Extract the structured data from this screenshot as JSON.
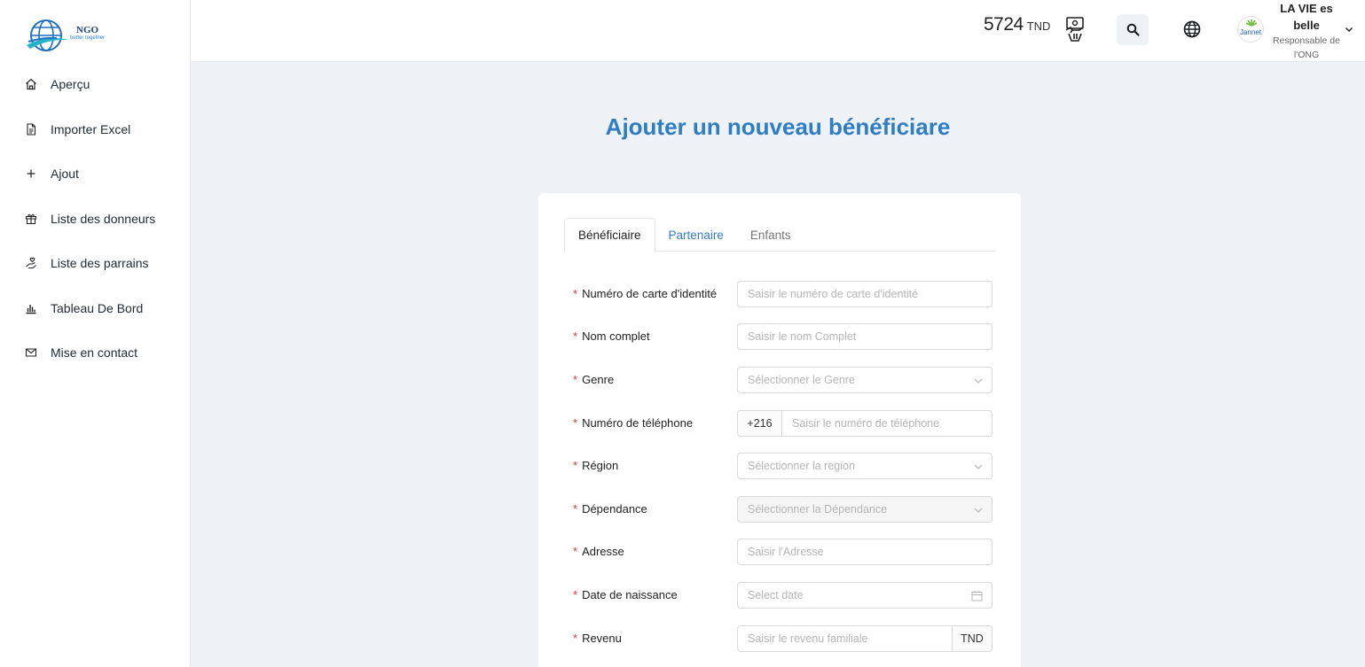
{
  "sidebar": {
    "logo": {
      "title": "NGO",
      "tagline": "better together"
    },
    "items": [
      {
        "label": "Aperçu",
        "icon": "home-icon"
      },
      {
        "label": "Importer Excel",
        "icon": "file-icon"
      },
      {
        "label": "Ajout",
        "icon": "plus-icon"
      },
      {
        "label": "Liste des donneurs",
        "icon": "gift-icon"
      },
      {
        "label": "Liste des parrains",
        "icon": "hand-heart-icon"
      },
      {
        "label": "Tableau De Bord",
        "icon": "bar-chart-icon"
      },
      {
        "label": "Mise en contact",
        "icon": "mail-icon"
      }
    ]
  },
  "header": {
    "balance_amount": "5724",
    "balance_unit": "TND",
    "user_name": "LA VIE es belle",
    "user_role": "Responsable de l'ONG",
    "avatar_text": "Jannet"
  },
  "page": {
    "title": "Ajouter un nouveau bénéficiare"
  },
  "tabs": [
    {
      "label": "Bénéficiaire",
      "state": "active"
    },
    {
      "label": "Partenaire",
      "state": "link"
    },
    {
      "label": "Enfants",
      "state": "inactive"
    }
  ],
  "form": {
    "fields": [
      {
        "label": "Numéro de carte d'identité",
        "placeholder": "Saisir le numéro de carte d'identité",
        "type": "text"
      },
      {
        "label": "Nom complet",
        "placeholder": "Saisir le nom Complet",
        "type": "text"
      },
      {
        "label": "Genre",
        "placeholder": "Sélectionner le Genre",
        "type": "select"
      },
      {
        "label": "Numéro de téléphone",
        "placeholder": "Saisir le numéro de téléphone",
        "type": "phone",
        "prefix": "+216"
      },
      {
        "label": "Région",
        "placeholder": "Sélectionner la region",
        "type": "select"
      },
      {
        "label": "Dépendance",
        "placeholder": "Sélectionner la Dépendance",
        "type": "select-disabled"
      },
      {
        "label": "Adresse",
        "placeholder": "Saisir l'Adresse",
        "type": "text"
      },
      {
        "label": "Date de naissance",
        "placeholder": "Select date",
        "type": "date"
      },
      {
        "label": "Revenu",
        "placeholder": "Saisir le revenu familiale",
        "type": "currency",
        "suffix": "TND"
      }
    ]
  },
  "colors": {
    "accent": "#2f7dc5",
    "required": "#e23b3b",
    "background": "#eef2f6"
  }
}
